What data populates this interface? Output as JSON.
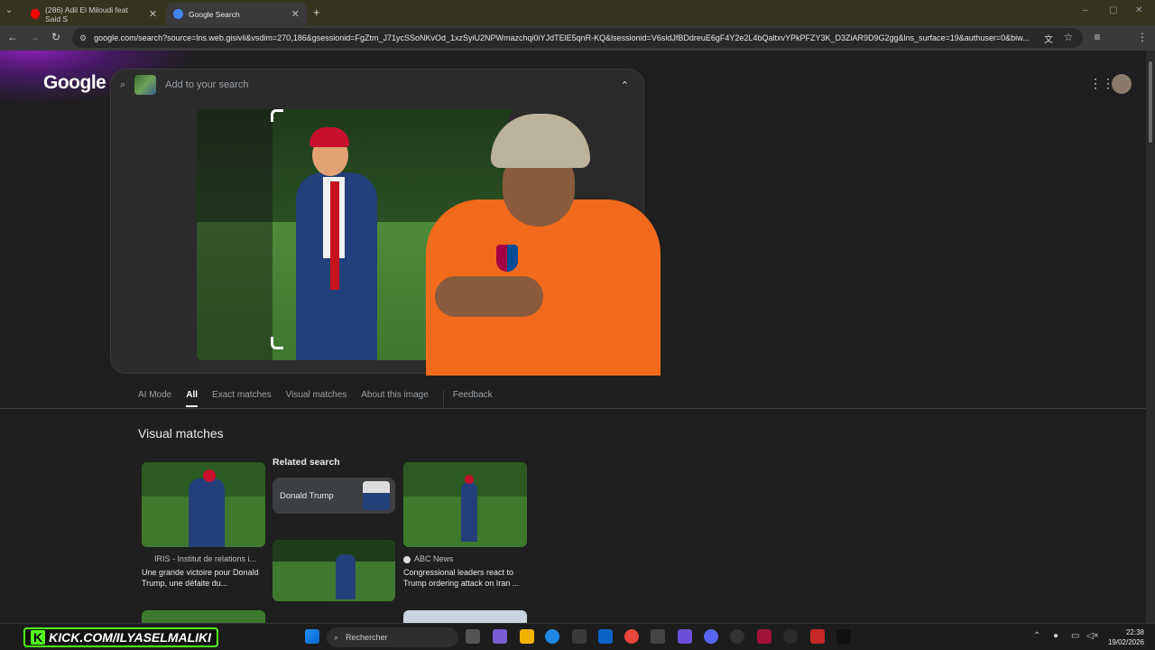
{
  "browser": {
    "tabs": [
      {
        "label": "(286) Adil El Miloudi feat Said S",
        "favicon_color": "#ff0000"
      },
      {
        "label": "Google Search",
        "favicon_color": "#4285f4"
      }
    ],
    "url": "google.com/search?source=lns.web.gisivli&vsdim=270,186&gsessionid=FgZtm_J71ycSSoNKvOd_1xzSyiU2NPWmazchqi0iYJdTElE5qnR-KQ&lsessionid=V6sldJfBDdreuE6gF4Y2e2L4bQaltxvYPkPFZY3K_D3ZiAR9D9G2gg&lns_surface=19&authuser=0&biw..."
  },
  "google": {
    "logo": "Google",
    "search_placeholder": "Add to your search",
    "tabs": [
      "AI Mode",
      "All",
      "Exact matches",
      "Visual matches",
      "About this image",
      "Feedback"
    ],
    "active_tab": "All",
    "section_title": "Visual matches",
    "related_title": "Related search",
    "related_chip": "Donald Trump",
    "results": [
      {
        "source": "IRIS - Institut de relations i...",
        "title": "Une grande victoire pour Donald Trump, une défaite du..."
      },
      {
        "source": "ABC News",
        "title": "Congressional leaders react to Trump ordering attack on Iran ..."
      }
    ]
  },
  "taskbar": {
    "kick": "KICK.COM/ILYASELMALIKI",
    "kick_badge": "K",
    "search": "Rechercher",
    "time": "22:38",
    "date": "19/02/2026"
  },
  "colors": {
    "kick_green": "#53fc18",
    "accent": "#8a1fb5"
  }
}
